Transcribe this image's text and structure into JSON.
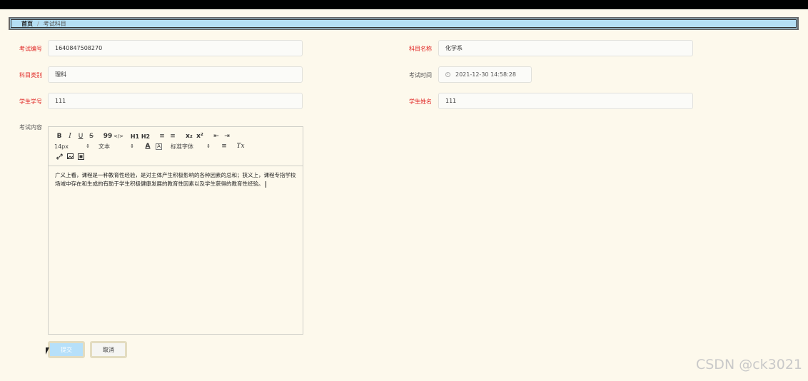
{
  "breadcrumb": {
    "home": "首页",
    "separator": "/",
    "current": "考试科目"
  },
  "form": {
    "exam_no": {
      "label": "考试编号",
      "value": "1640847508270"
    },
    "subject_name": {
      "label": "科目名称",
      "value": "化学系"
    },
    "subject_type": {
      "label": "科目类别",
      "value": "理科"
    },
    "exam_time": {
      "label": "考试时间",
      "value": "2021-12-30 14:58:28"
    },
    "student_id": {
      "label": "学生学号",
      "value": "111"
    },
    "student_name": {
      "label": "学生姓名",
      "value": "111"
    },
    "content": {
      "label": "考试内容",
      "text": "广义上看，课程是一种教育性经验，是对主体产生积极影响的各种因素的总和；狭义上，课程专指学校场域中存在和生成的有助于学生积极健康发展的教育性因素以及学生获得的教育性经验。"
    }
  },
  "toolbar": {
    "bold": "B",
    "italic": "I",
    "underline": "U",
    "strike": "S",
    "quote": "99",
    "code": "</>",
    "h1": "H1",
    "h2": "H2",
    "ordered_list": "≡",
    "bullet_list": "≡",
    "subscript": "x₂",
    "superscript": "x²",
    "outdent": "⇤",
    "indent": "⇥",
    "size": "14px",
    "header": "文本",
    "font": "标准字体",
    "text_color": "A",
    "bg_color": "A",
    "align": "≡",
    "clean": "Tx"
  },
  "buttons": {
    "submit": "提交",
    "cancel": "取消"
  },
  "watermark": "CSDN @ck3021"
}
